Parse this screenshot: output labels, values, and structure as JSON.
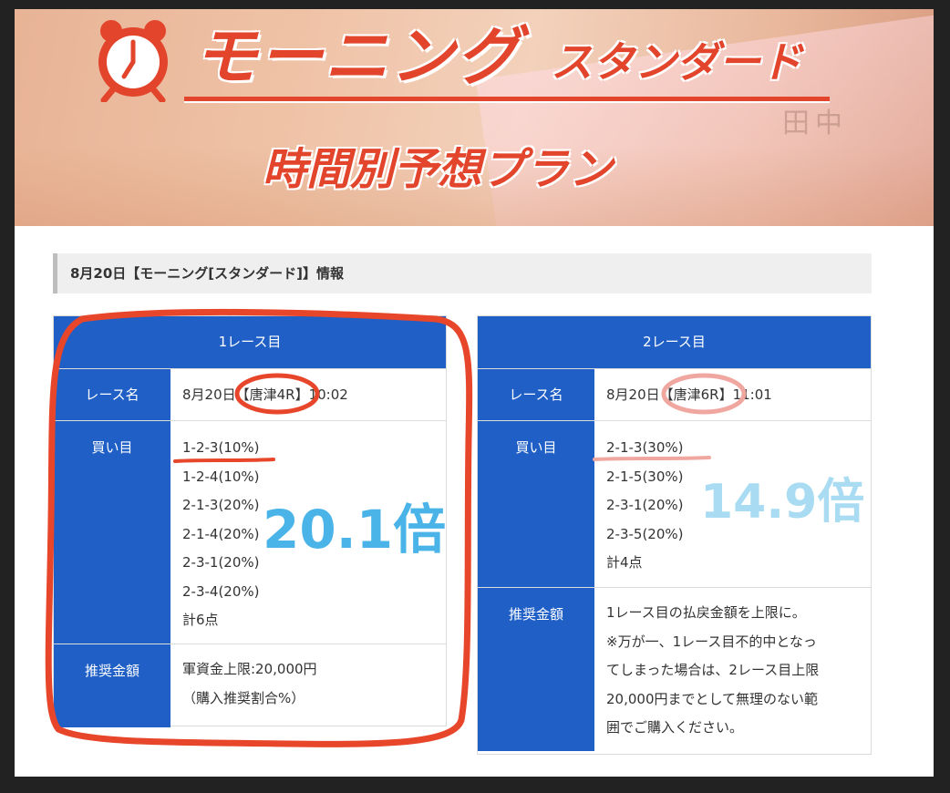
{
  "banner": {
    "title_main": "モーニング",
    "title_sub": "スタンダード",
    "title_plan": "時間別予想プラン",
    "accent_color": "#e2452b",
    "icon": "alarm-clock-icon",
    "background_sign": "田中"
  },
  "info_heading": "8月20日【モーニング[スタンダード]】情報",
  "race1": {
    "header": "1レース目",
    "race_name_label": "レース名",
    "race_name_value": "8月20日【唐津4R】10:02",
    "bets_label": "買い目",
    "bets": [
      "1-2-3(10%)",
      "1-2-4(10%)",
      "2-1-3(20%)",
      "2-1-4(20%)",
      "2-3-1(20%)",
      "2-3-4(20%)",
      "計6点"
    ],
    "amount_label": "推奨金額",
    "amount_lines": [
      "軍資金上限:20,000円",
      "（購入推奨割合%）"
    ]
  },
  "race2": {
    "header": "2レース目",
    "race_name_label": "レース名",
    "race_name_value": "8月20日【唐津6R】11:01",
    "bets_label": "買い目",
    "bets": [
      "2-1-3(30%)",
      "2-1-5(30%)",
      "2-3-1(20%)",
      "2-3-5(20%)",
      "計4点"
    ],
    "amount_label": "推奨金額",
    "amount_lines": [
      "1レース目の払戻金額を上限に。",
      "※万が一、1レース目不的中となっ",
      "てしまった場合は、2レース目上限",
      "20,000円までとして無理のない範",
      "囲でご購入ください。"
    ]
  },
  "annotations": {
    "multiplier_1": "20.1倍",
    "multiplier_2": "14.9倍",
    "highlight_color_1": "#e8462a",
    "highlight_color_2": "#f0a7a0",
    "multiplier_color_1": "#4ab3e8",
    "multiplier_color_2": "#a9dcf2"
  },
  "colors": {
    "table_header": "#1f5fc6",
    "heading_bg": "#efefef"
  }
}
